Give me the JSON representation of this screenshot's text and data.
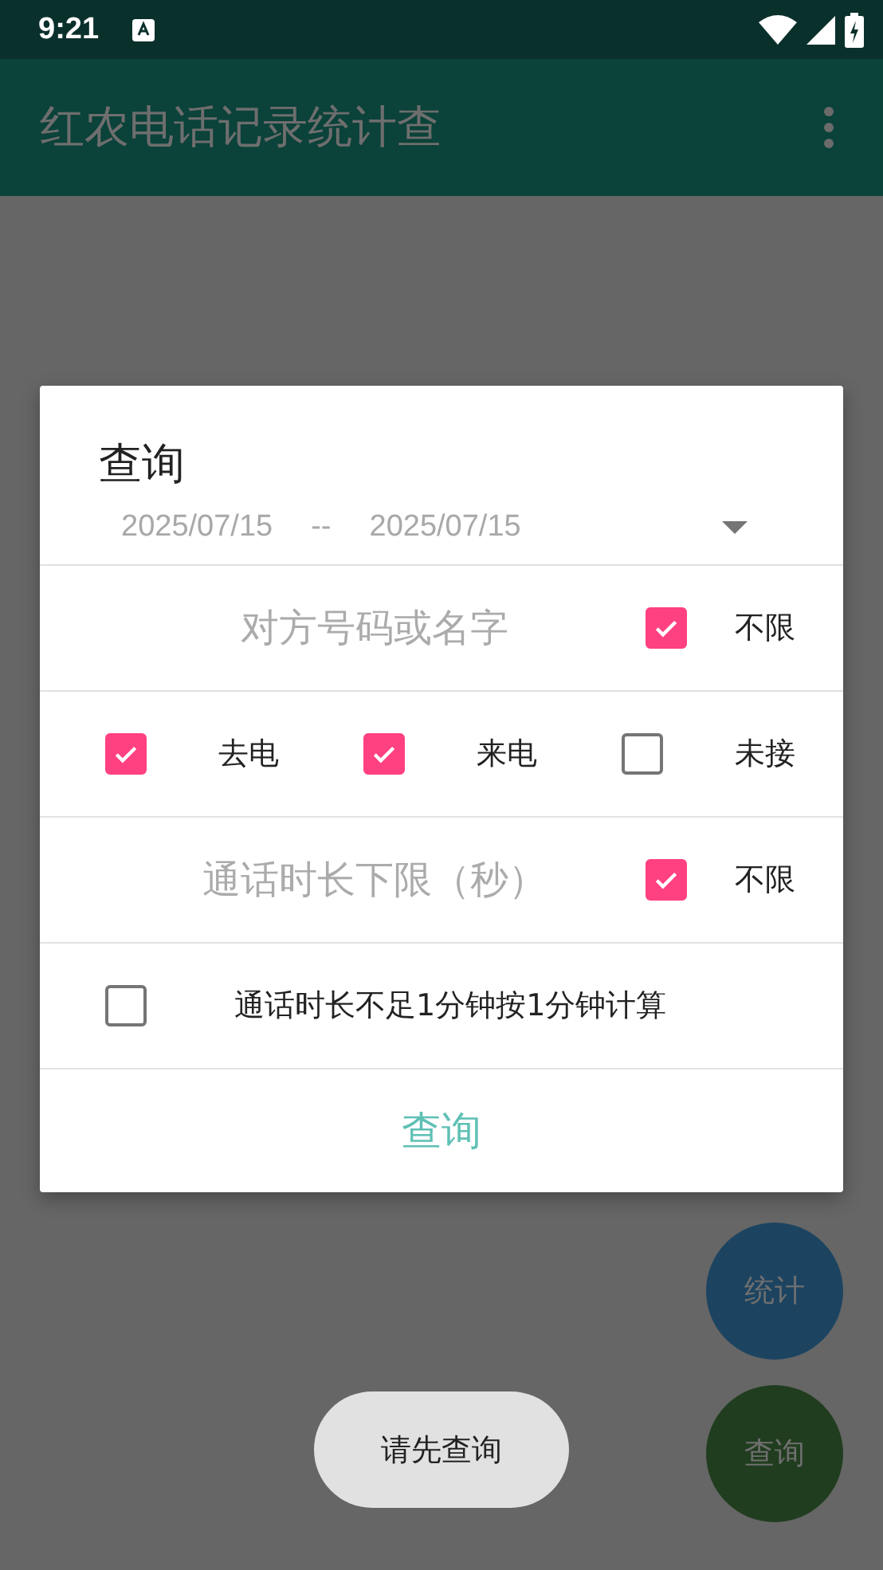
{
  "status_bar": {
    "time": "9:21"
  },
  "app_bar": {
    "title": "红农电话记录统计查"
  },
  "dialog": {
    "title": "查询",
    "date_from": "2025/07/15",
    "date_separator": "--",
    "date_to": "2025/07/15",
    "contact_field": {
      "placeholder": "对方号码或名字"
    },
    "contact_unlimited": {
      "label": "不限",
      "checked": true
    },
    "call_types": [
      {
        "label": "去电",
        "checked": true
      },
      {
        "label": "来电",
        "checked": true
      },
      {
        "label": "未接",
        "checked": false
      }
    ],
    "duration_field": {
      "placeholder": "通话时长下限（秒）"
    },
    "duration_unlimited": {
      "label": "不限",
      "checked": true
    },
    "round_up": {
      "label": "通话时长不足1分钟按1分钟计算",
      "checked": false
    },
    "button": "查询"
  },
  "fabs": [
    {
      "label": "统计",
      "color": "#1c4461"
    },
    {
      "label": "查询",
      "color": "#213d1f"
    }
  ],
  "toast": "请先查询"
}
